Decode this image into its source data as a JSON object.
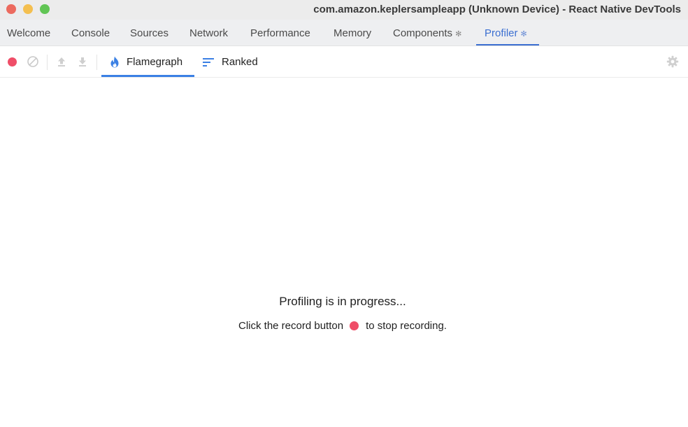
{
  "window": {
    "title": "com.amazon.keplersampleapp (Unknown Device) - React Native DevTools"
  },
  "tabs": [
    {
      "label": "Welcome"
    },
    {
      "label": "Console"
    },
    {
      "label": "Sources"
    },
    {
      "label": "Network"
    },
    {
      "label": "Performance"
    },
    {
      "label": "Memory"
    },
    {
      "label": "Components",
      "has_gear": true
    },
    {
      "label": "Profiler",
      "has_gear": true,
      "active": true
    }
  ],
  "toolbar": {
    "view_tabs": [
      {
        "label": "Flamegraph",
        "icon": "flame-icon",
        "active": true
      },
      {
        "label": "Ranked",
        "icon": "ranked-icon"
      }
    ]
  },
  "main": {
    "title": "Profiling is in progress...",
    "hint_before": "Click the record button",
    "hint_after": "to stop recording."
  },
  "colors": {
    "accent": "#3b6fd1",
    "record": "#ef4e68",
    "flame": "#3b80e4"
  }
}
